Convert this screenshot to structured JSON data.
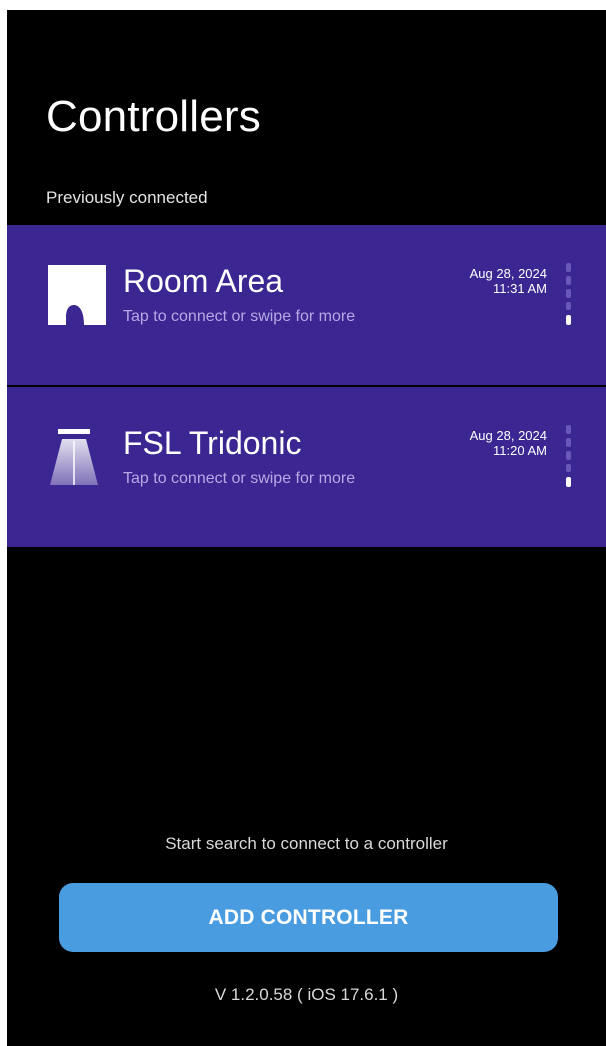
{
  "header": {
    "title": "Controllers",
    "section_label": "Previously connected"
  },
  "theme": {
    "card_background": "#3c2691",
    "card_hint_color": "#b6a9e6",
    "accent_button": "#4a9ce0"
  },
  "controllers": [
    {
      "name": "Room Area",
      "hint": "Tap to connect or swipe for more",
      "date": "Aug 28, 2024",
      "time": "11:31 AM",
      "icon": "room-area-icon"
    },
    {
      "name": "FSL Tridonic",
      "hint": "Tap to connect or swipe for more",
      "date": "Aug 28, 2024",
      "time": "11:20 AM",
      "icon": "ceiling-light-icon"
    }
  ],
  "footer": {
    "hint": "Start search to connect to a controller",
    "add_button_label": "ADD CONTROLLER",
    "version": "V 1.2.0.58 ( iOS 17.6.1 )"
  }
}
